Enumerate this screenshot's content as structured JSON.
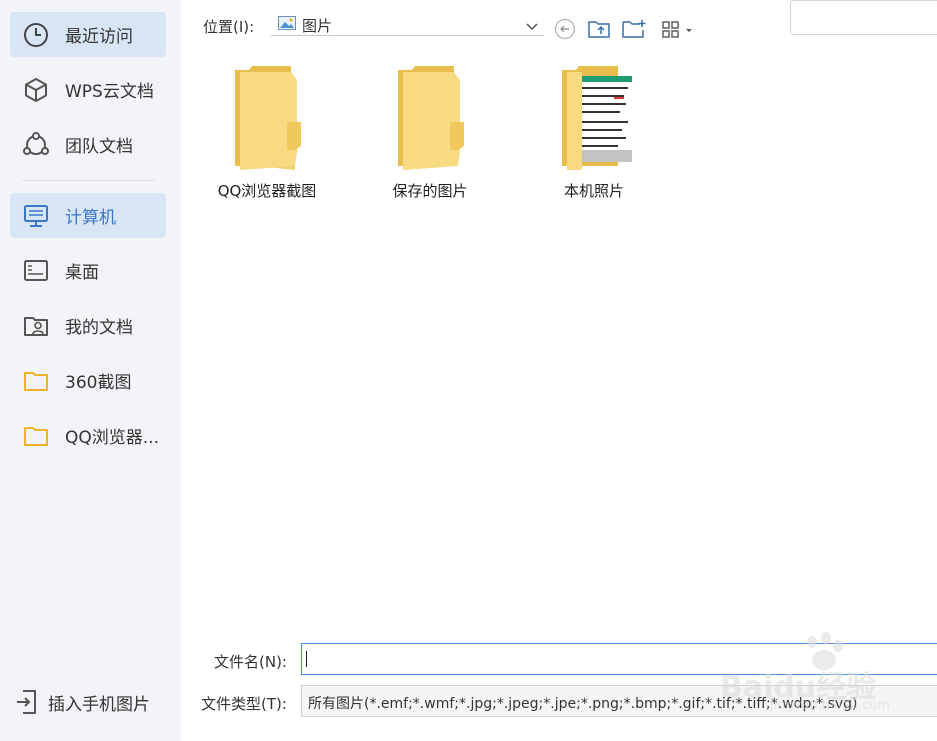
{
  "sidebar": {
    "items": [
      {
        "label": "最近访问",
        "icon": "clock-icon"
      },
      {
        "label": "WPS云文档",
        "icon": "cube-icon"
      },
      {
        "label": "团队文档",
        "icon": "team-icon"
      },
      {
        "label": "计算机",
        "icon": "monitor-icon"
      },
      {
        "label": "桌面",
        "icon": "desktop-icon"
      },
      {
        "label": "我的文档",
        "icon": "user-folder-icon"
      },
      {
        "label": "360截图",
        "icon": "folder-icon"
      },
      {
        "label": "QQ浏览器...",
        "icon": "folder-icon"
      }
    ],
    "insert_phone_label": "插入手机图片"
  },
  "toolbar": {
    "location_label": "位置(I):",
    "location_value": "图片",
    "back_icon": "back-arrow-icon",
    "up_folder_icon": "folder-up-icon",
    "new_folder_icon": "new-folder-icon",
    "view_icon": "grid-view-icon"
  },
  "files": [
    {
      "name": "QQ浏览器截图",
      "icon": "folder-icon"
    },
    {
      "name": "保存的图片",
      "icon": "folder-icon"
    },
    {
      "name": "本机照片",
      "icon": "folder-thumbnail-icon"
    }
  ],
  "bottom": {
    "filename_label": "文件名(N):",
    "filename_value": "",
    "filetype_label": "文件类型(T):",
    "filetype_value": "所有图片(*.emf;*.wmf;*.jpg;*.jpeg;*.jpe;*.png;*.bmp;*.gif;*.tif;*.tiff;*.wdp;*.svg)"
  },
  "watermark": {
    "text": "Baidu经验",
    "url": "jingyan.baidu.com"
  },
  "colors": {
    "accent": "#3b76c8",
    "sidebar_bg": "#f2f4f7",
    "active_bg": "#d7e5f5",
    "folder_yellow": "#f5d672"
  }
}
